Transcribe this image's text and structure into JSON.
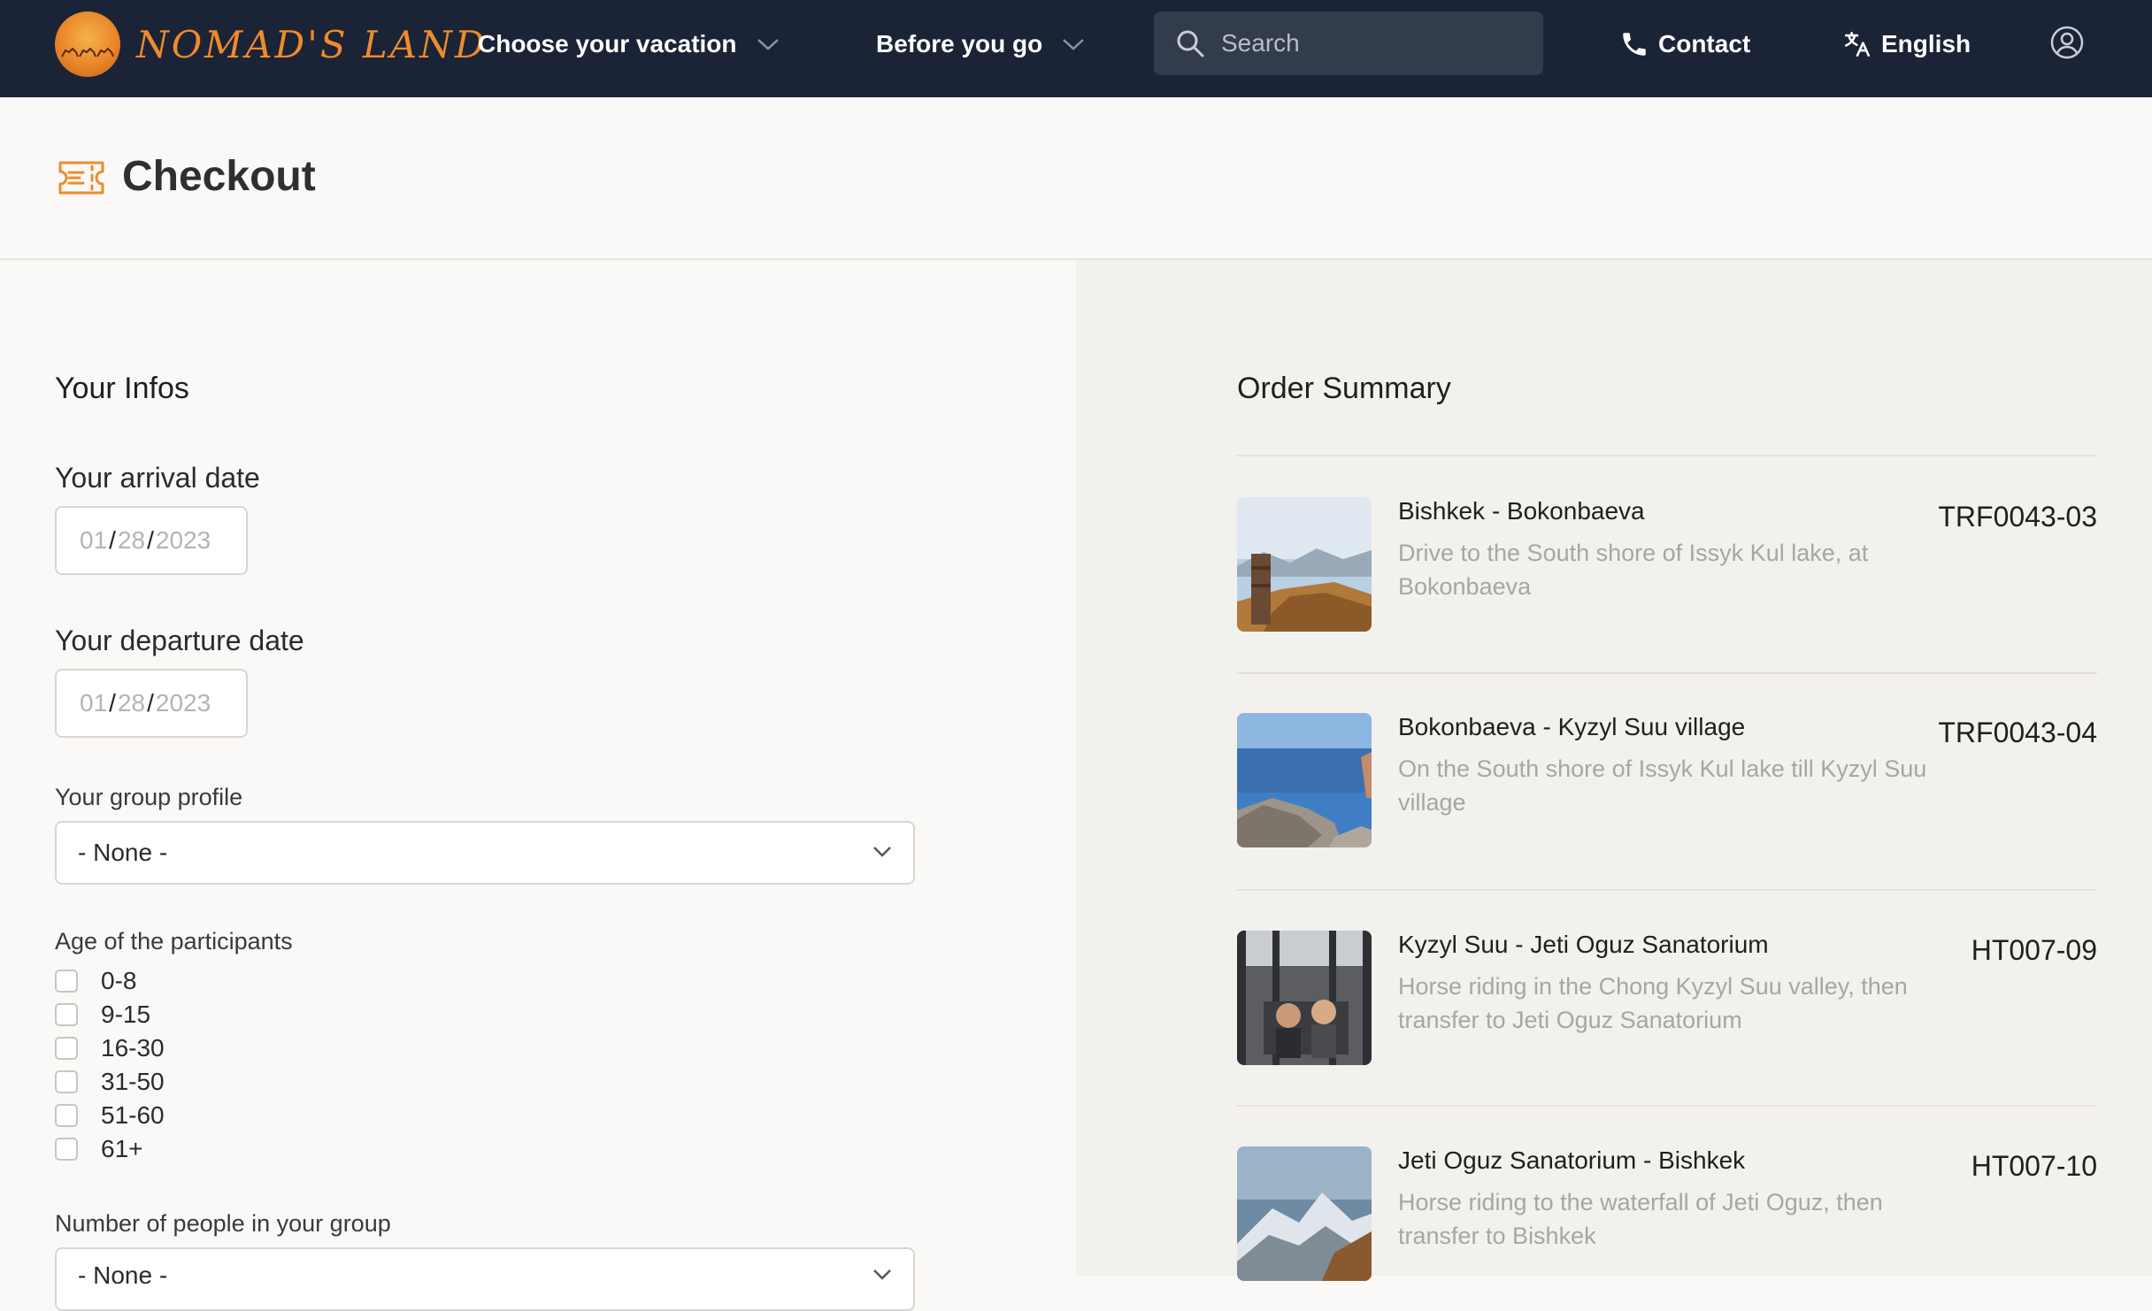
{
  "brand": {
    "name": "NOMAD'S LAND"
  },
  "nav": {
    "choose_vacation": "Choose your vacation",
    "before_you_go": "Before you go",
    "search_placeholder": "Search",
    "contact": "Contact",
    "language": "English"
  },
  "page": {
    "title": "Checkout"
  },
  "infos": {
    "heading": "Your Infos",
    "arrival_label": "Your arrival date",
    "arrival": {
      "mm": "01",
      "dd": "28",
      "yyyy": "2023"
    },
    "departure_label": "Your departure date",
    "departure": {
      "mm": "01",
      "dd": "28",
      "yyyy": "2023"
    },
    "group_profile_label": "Your group profile",
    "group_profile_value": "- None -",
    "age_label": "Age of the participants",
    "ages": [
      "0-8",
      "9-15",
      "16-30",
      "31-50",
      "51-60",
      "61+"
    ],
    "people_label": "Number of people in your group",
    "people_value": "- None -"
  },
  "summary": {
    "heading": "Order Summary",
    "items": [
      {
        "title": "Bishkek - Bokonbaeva",
        "desc": "Drive to the South shore of Issyk Kul lake, at Bokonbaeva",
        "code": "TRF0043-03"
      },
      {
        "title": "Bokonbaeva - Kyzyl Suu village",
        "desc": "On the South shore of Issyk Kul lake till Kyzyl Suu village",
        "code": "TRF0043-04"
      },
      {
        "title": "Kyzyl Suu - Jeti Oguz Sanatorium",
        "desc": "Horse riding in the Chong Kyzyl Suu valley, then transfer to Jeti Oguz Sanatorium",
        "code": "HT007-09"
      },
      {
        "title": "Jeti Oguz Sanatorium - Bishkek",
        "desc": "Horse riding to the waterfall of Jeti Oguz, then transfer to Bishkek",
        "code": "HT007-10"
      }
    ]
  },
  "icons": {
    "search": "search-icon",
    "phone": "phone-icon",
    "translate": "translate-icon",
    "account": "account-icon",
    "ticket": "ticket-icon",
    "chevron": "chevron-down-icon"
  },
  "colors": {
    "header_bg": "#1b2436",
    "accent": "#ef8b2c",
    "muted_text": "#a6a6a6"
  }
}
